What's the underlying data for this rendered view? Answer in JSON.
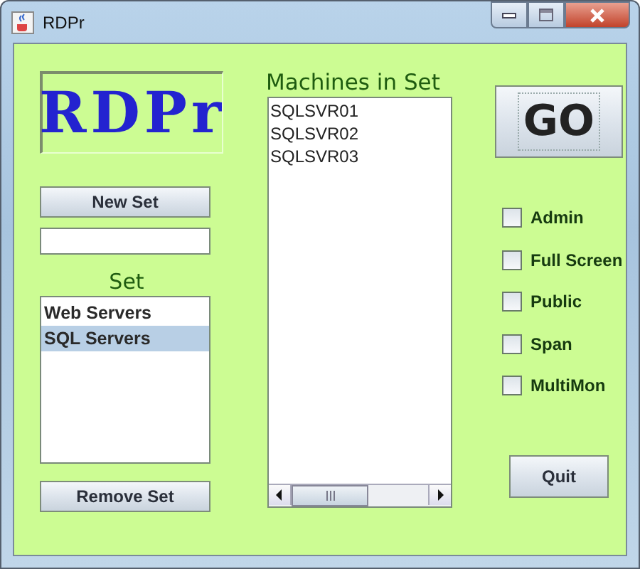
{
  "window": {
    "title": "RDPr"
  },
  "logo": {
    "text": "RDPr"
  },
  "new_set_button": "New Set",
  "set_list": {
    "label": "Set",
    "items": [
      {
        "label": "Web Servers",
        "selected": false
      },
      {
        "label": "SQL Servers",
        "selected": true
      }
    ]
  },
  "remove_set_button": "Remove Set",
  "machines": {
    "label": "Machines in Set",
    "items": [
      "SQLSVR01",
      "SQLSVR02",
      "SQLSVR03"
    ]
  },
  "go_button": "GO",
  "options": [
    {
      "label": "Admin",
      "checked": false
    },
    {
      "label": "Full Screen",
      "checked": false
    },
    {
      "label": "Public",
      "checked": false
    },
    {
      "label": "Span",
      "checked": false
    },
    {
      "label": "MultiMon",
      "checked": false
    }
  ],
  "quit_button": "Quit"
}
